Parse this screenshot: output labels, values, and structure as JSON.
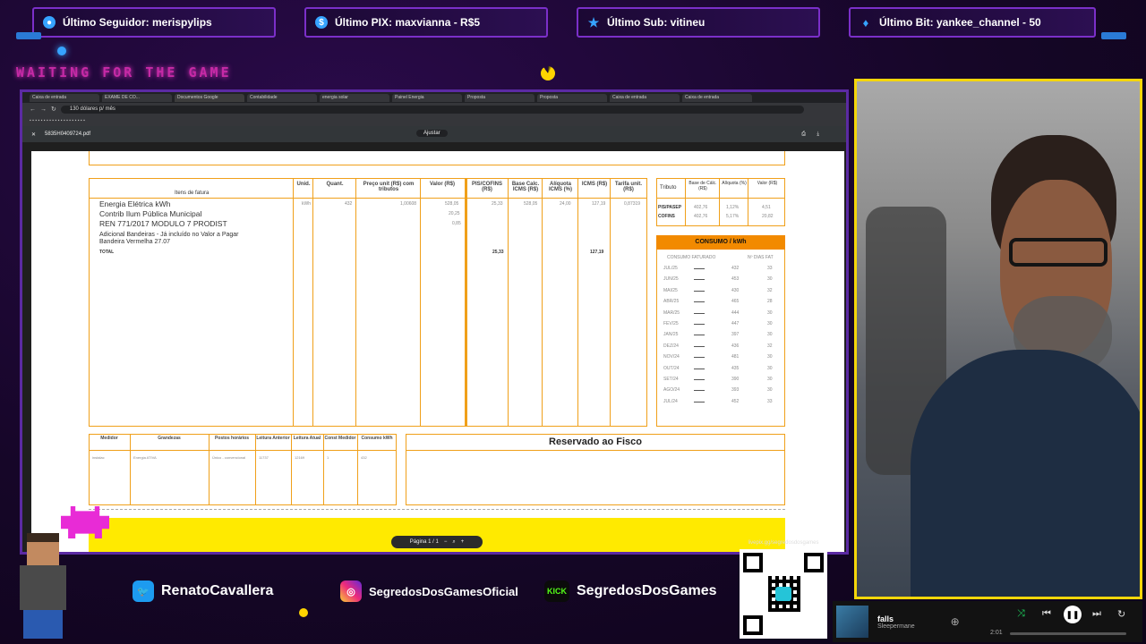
{
  "alerts": [
    {
      "label": "Último Seguidor: merispylips",
      "icon": "user-icon"
    },
    {
      "label": "Último PIX: maxvianna - R$5",
      "icon": "dollar-icon"
    },
    {
      "label": "Último Sub: vitineu",
      "icon": "star-icon"
    },
    {
      "label": "Último Bit: yankee_channel - 50",
      "icon": "diamond-icon"
    }
  ],
  "waiting": "WAITING FOR THE GAME",
  "browser": {
    "tabs": [
      "Caixa de entrada",
      "EXAME DE CO...",
      "Documentos Google",
      "Contabilidade",
      "energia solar",
      "Painel Energia",
      "Proposta",
      "Proposta",
      "Caixa de entrada",
      "Caixa de entrada"
    ],
    "url": "130 dólares p/ mês",
    "pdf_filename": "5835H0409724.pdf",
    "zoom": "Ajustar"
  },
  "invoice": {
    "items_header": "Itens de fatura",
    "col_heads": [
      "Unid.",
      "Quant.",
      "Preço unit (R$) com tributos",
      "Valor (R$)",
      "PIS/COFINS (R$)",
      "Base Calc. ICMS (R$)",
      "Alíquota ICMS (%)",
      "ICMS (R$)",
      "Tarifa unit. (R$)"
    ],
    "items": [
      "Energia Elétrica kWh",
      "Contrib Ilum Pública Municipal",
      "REN 771/2017 MODULO 7 PRODIST"
    ],
    "sub_items": [
      "Adicional Bandeiras - Já incluído no Valor a Pagar",
      "Bandeira Vermelha 27.07"
    ],
    "row_vals": {
      "unid": "kWh",
      "quant": "432",
      "preco": "1,00608",
      "valor1": "528,05",
      "valor2": "20,25",
      "valor3": "0,85",
      "pis": "25,33",
      "base": "528,05",
      "aliq": "24,00",
      "icms": "127,19",
      "tarifa": "0,87319"
    },
    "total_label": "TOTAL",
    "total_pis": "25,33",
    "total_icms": "127,19",
    "tributo_header": [
      "Tributo",
      "Base de Cálc. (R$)",
      "Alíquota (%)",
      "Valor (R$)"
    ],
    "tributos": [
      {
        "name": "PIS/PASEP",
        "base": "402,76",
        "aliq": "1,12%",
        "valor": "4,51"
      },
      {
        "name": "COFINS",
        "base": "402,76",
        "aliq": "5,17%",
        "valor": "20,82"
      }
    ],
    "consumo_title": "CONSUMO / kWh",
    "consumo_cols": [
      "CONSUMO FATURADO",
      "Nº DIAS FAT"
    ],
    "consumo": [
      {
        "m": "JUL/25",
        "v": "432",
        "d": "33"
      },
      {
        "m": "JUN/25",
        "v": "453",
        "d": "30"
      },
      {
        "m": "MAI/25",
        "v": "430",
        "d": "32"
      },
      {
        "m": "ABR/25",
        "v": "465",
        "d": "28"
      },
      {
        "m": "MAR/25",
        "v": "444",
        "d": "30"
      },
      {
        "m": "FEV/25",
        "v": "447",
        "d": "30"
      },
      {
        "m": "JAN/25",
        "v": "397",
        "d": "30"
      },
      {
        "m": "DEZ/24",
        "v": "436",
        "d": "32"
      },
      {
        "m": "NOV/24",
        "v": "481",
        "d": "30"
      },
      {
        "m": "OUT/24",
        "v": "435",
        "d": "30"
      },
      {
        "m": "SET/24",
        "v": "390",
        "d": "30"
      },
      {
        "m": "AGO/24",
        "v": "393",
        "d": "30"
      },
      {
        "m": "JUL/24",
        "v": "452",
        "d": "33"
      }
    ],
    "medidor_heads": [
      "Medidor",
      "Grandezas",
      "Postos horários",
      "Leitura Anterior",
      "Leitura Atual",
      "Const Medidor",
      "Consumo kWh"
    ],
    "medidor_row": [
      "instalac",
      "Energia ATIVA",
      "Único - convencional",
      "11737",
      "12169",
      "1",
      "432"
    ],
    "fisco": "Reservado ao Fisco",
    "page_nav": "Página 1 / 1"
  },
  "socials": [
    {
      "name": "RenatoCavallera",
      "icon": "twitter-icon",
      "color": "#1d9bf0"
    },
    {
      "name": "SegredosDosGamesOficial",
      "icon": "instagram-icon",
      "color": "#e1306c"
    },
    {
      "name": "SegredosDosGames",
      "icon": "kick-icon",
      "color": "#53fc18"
    }
  ],
  "qr_link": "livepix.gg/segredosdosgames",
  "spotify": {
    "title": "falls",
    "artist": "Sleepermane",
    "time": "2:01"
  }
}
